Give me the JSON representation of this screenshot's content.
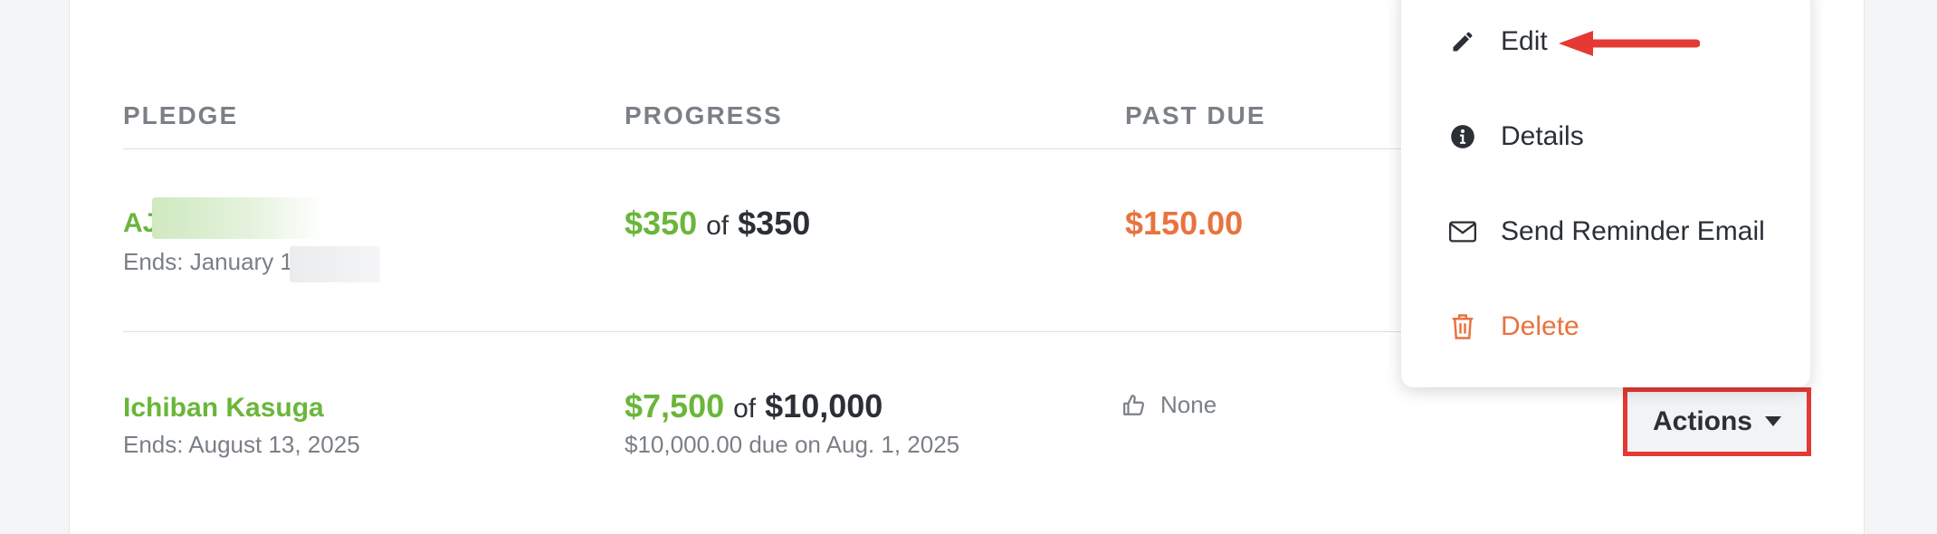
{
  "table": {
    "headers": {
      "pledge": "PLEDGE",
      "progress": "PROGRESS",
      "past_due": "PAST DUE"
    },
    "rows": [
      {
        "name": "AJ",
        "ends": "Ends: January 1",
        "progress_paid": "$350",
        "progress_of": "of",
        "progress_total": "$350",
        "due_note": "",
        "past_due": "$150.00"
      },
      {
        "name": "Ichiban Kasuga",
        "ends": "Ends: August 13, 2025",
        "progress_paid": "$7,500",
        "progress_of": "of",
        "progress_total": "$10,000",
        "due_note": "$10,000.00 due on Aug. 1, 2025",
        "past_due": "None",
        "past_due_icon": "thumbs-up-icon"
      }
    ]
  },
  "actions_button": {
    "label": "Actions",
    "icon": "caret-down-icon"
  },
  "menu": {
    "items": [
      {
        "label": "Edit",
        "icon": "pencil-icon"
      },
      {
        "label": "Details",
        "icon": "info-icon"
      },
      {
        "label": "Send Reminder Email",
        "icon": "envelope-icon"
      },
      {
        "label": "Delete",
        "icon": "trash-icon"
      }
    ]
  },
  "colors": {
    "brand_green": "#6ab63a",
    "past_due_orange": "#e8733e",
    "highlight_red": "#e53935",
    "text_dark": "#2b2f36",
    "text_muted": "#7a7f86"
  }
}
